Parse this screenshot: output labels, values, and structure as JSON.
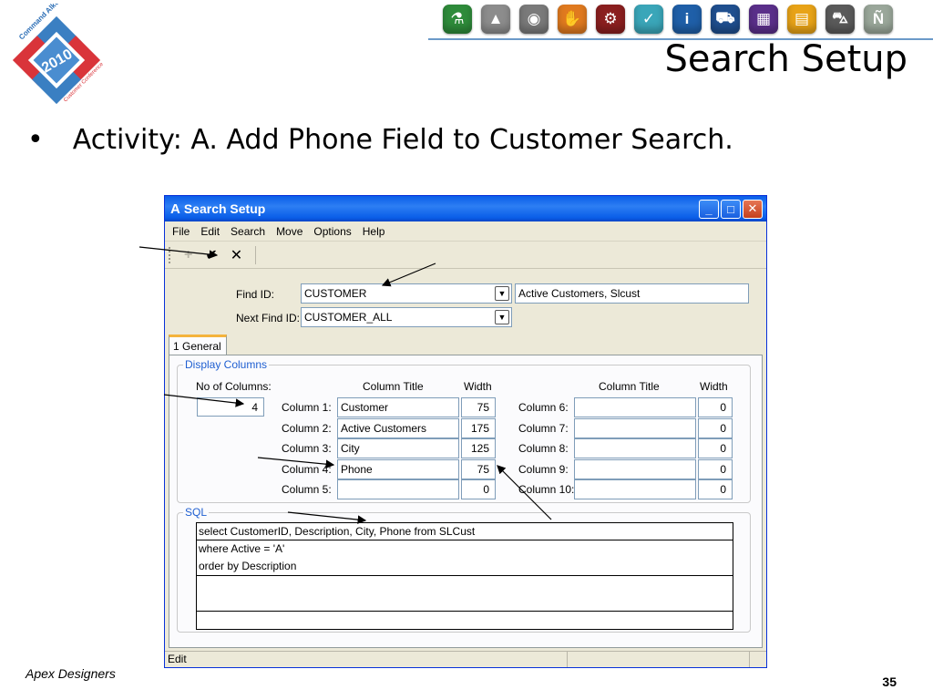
{
  "slide": {
    "title": "Search Setup",
    "bullet_symbol": "•",
    "bullet_text": "Activity:  A.  Add Phone Field to Customer Search.",
    "footer": "Apex Designers",
    "page_number": "35"
  },
  "logo": {
    "line1": "Command Alkon",
    "year": "2010",
    "line2": "Customer Conference"
  },
  "app_icons": [
    {
      "name": "flask-icon",
      "color": "#2e8b3a",
      "glyph": "⚗"
    },
    {
      "name": "road-icon",
      "color": "#8c8c8c",
      "glyph": "▲"
    },
    {
      "name": "globe-icon",
      "color": "#7a7a7a",
      "glyph": "◉"
    },
    {
      "name": "hand-icon",
      "color": "#e07a1f",
      "glyph": "✋"
    },
    {
      "name": "gears-icon",
      "color": "#8b1f1f",
      "glyph": "⚙"
    },
    {
      "name": "check-icon",
      "color": "#3aa6b9",
      "glyph": "✓"
    },
    {
      "name": "info-icon",
      "color": "#1f5fa8",
      "glyph": "i"
    },
    {
      "name": "dispatch-icon",
      "color": "#1f4f8f",
      "glyph": "⛟"
    },
    {
      "name": "grid-icon",
      "color": "#5a2f8a",
      "glyph": "▦"
    },
    {
      "name": "window-icon",
      "color": "#e8a317",
      "glyph": "▤"
    },
    {
      "name": "truck-icon",
      "color": "#5a5a5a",
      "glyph": "⛍"
    },
    {
      "name": "n-icon",
      "color": "#9aa79a",
      "glyph": "Ñ"
    }
  ],
  "window": {
    "title": "Search Setup",
    "app_glyph": "A",
    "minimize": "_",
    "maximize": "□",
    "close": "✕"
  },
  "menu": [
    "File",
    "Edit",
    "Search",
    "Move",
    "Options",
    "Help"
  ],
  "toolbar": {
    "add": "+",
    "save": "✔",
    "cancel": "✕"
  },
  "form": {
    "find_id_label": "Find ID:",
    "find_id_value": "CUSTOMER",
    "find_id_description": "Active Customers, Slcust",
    "next_find_id_label": "Next Find ID:",
    "next_find_id_value": "CUSTOMER_ALL",
    "dropdown_arrow": "▼"
  },
  "tab": {
    "label": "1 General"
  },
  "display_columns": {
    "legend": "Display Columns",
    "num_columns_label": "No of Columns:",
    "num_columns_value": "4",
    "col_title_header": "Column Title",
    "width_header": "Width",
    "left": [
      {
        "label": "Column 1:",
        "title": "Customer",
        "width": "75"
      },
      {
        "label": "Column 2:",
        "title": "Active Customers",
        "width": "175"
      },
      {
        "label": "Column 3:",
        "title": "City",
        "width": "125"
      },
      {
        "label": "Column 4:",
        "title": "Phone",
        "width": "75"
      },
      {
        "label": "Column 5:",
        "title": "",
        "width": "0"
      }
    ],
    "right": [
      {
        "label": "Column 6:",
        "title": "",
        "width": "0"
      },
      {
        "label": "Column 7:",
        "title": "",
        "width": "0"
      },
      {
        "label": "Column 8:",
        "title": "",
        "width": "0"
      },
      {
        "label": "Column 9:",
        "title": "",
        "width": "0"
      },
      {
        "label": "Column 10:",
        "title": "",
        "width": "0"
      }
    ]
  },
  "sql": {
    "legend": "SQL",
    "lines": [
      "select CustomerID, Description, City, Phone from SLCust",
      "where Active = 'A'",
      "order by Description",
      "",
      "",
      ""
    ]
  },
  "status": {
    "mode": "Edit"
  }
}
